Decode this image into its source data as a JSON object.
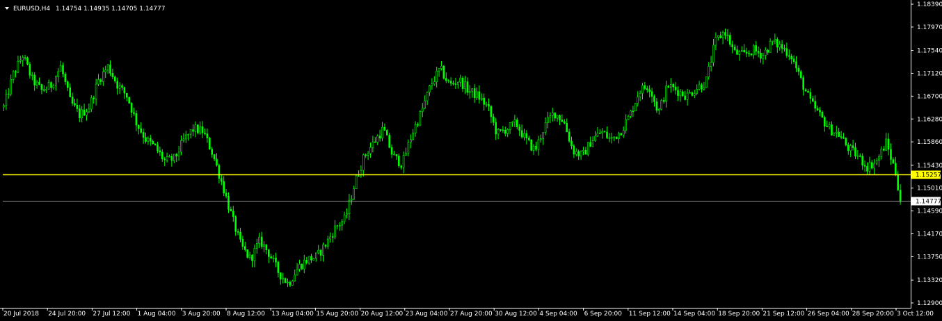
{
  "header": {
    "symbol": "EURUSD,H4",
    "ohlc": "1.14754 1.14935 1.14705 1.14777"
  },
  "chart_data": {
    "type": "candlestick",
    "symbol": "EURUSD",
    "timeframe": "H4",
    "ylim": [
      1.129,
      1.1839
    ],
    "y_ticks": [
      "1.18390",
      "1.17970",
      "1.17540",
      "1.17120",
      "1.16700",
      "1.16280",
      "1.15860",
      "1.15430",
      "1.15010",
      "1.14590",
      "1.14170",
      "1.13750",
      "1.13320",
      "1.12900"
    ],
    "x_ticks": [
      "20 Jul 2018",
      "24 Jul 20:00",
      "27 Jul 12:00",
      "1 Aug 04:00",
      "3 Aug 20:00",
      "8 Aug 12:00",
      "13 Aug 04:00",
      "15 Aug 20:00",
      "20 Aug 12:00",
      "23 Aug 04:00",
      "27 Aug 20:00",
      "30 Aug 12:00",
      "4 Sep 04:00",
      "6 Sep 20:00",
      "11 Sep 12:00",
      "14 Sep 04:00",
      "18 Sep 20:00",
      "21 Sep 12:00",
      "26 Sep 04:00",
      "28 Sep 20:00",
      "3 Oct 12:00"
    ],
    "close_path": [
      [
        0,
        1.165
      ],
      [
        4,
        1.171
      ],
      [
        8,
        1.1745
      ],
      [
        12,
        1.17
      ],
      [
        16,
        1.168
      ],
      [
        20,
        1.169
      ],
      [
        24,
        1.1725
      ],
      [
        28,
        1.166
      ],
      [
        32,
        1.1635
      ],
      [
        36,
        1.165
      ],
      [
        40,
        1.17
      ],
      [
        44,
        1.1725
      ],
      [
        48,
        1.169
      ],
      [
        52,
        1.167
      ],
      [
        56,
        1.162
      ],
      [
        60,
        1.159
      ],
      [
        64,
        1.1575
      ],
      [
        68,
        1.155
      ],
      [
        72,
        1.1555
      ],
      [
        76,
        1.159
      ],
      [
        80,
        1.161
      ],
      [
        84,
        1.1605
      ],
      [
        88,
        1.1565
      ],
      [
        92,
        1.151
      ],
      [
        96,
        1.145
      ],
      [
        100,
        1.1395
      ],
      [
        104,
        1.137
      ],
      [
        108,
        1.1405
      ],
      [
        112,
        1.138
      ],
      [
        116,
        1.1345
      ],
      [
        120,
        1.1325
      ],
      [
        124,
        1.1355
      ],
      [
        128,
        1.137
      ],
      [
        132,
        1.1375
      ],
      [
        136,
        1.14
      ],
      [
        140,
        1.143
      ],
      [
        144,
        1.1445
      ],
      [
        148,
        1.151
      ],
      [
        152,
        1.156
      ],
      [
        156,
        1.1585
      ],
      [
        160,
        1.161
      ],
      [
        164,
        1.156
      ],
      [
        168,
        1.1545
      ],
      [
        172,
        1.16
      ],
      [
        176,
        1.164
      ],
      [
        180,
        1.169
      ],
      [
        184,
        1.172
      ],
      [
        188,
        1.169
      ],
      [
        192,
        1.17
      ],
      [
        196,
        1.168
      ],
      [
        200,
        1.167
      ],
      [
        204,
        1.165
      ],
      [
        208,
        1.16
      ],
      [
        212,
        1.161
      ],
      [
        216,
        1.162
      ],
      [
        220,
        1.159
      ],
      [
        224,
        1.157
      ],
      [
        228,
        1.1615
      ],
      [
        232,
        1.164
      ],
      [
        236,
        1.1625
      ],
      [
        240,
        1.157
      ],
      [
        244,
        1.156
      ],
      [
        248,
        1.159
      ],
      [
        252,
        1.1605
      ],
      [
        256,
        1.159
      ],
      [
        260,
        1.1605
      ],
      [
        264,
        1.1635
      ],
      [
        268,
        1.168
      ],
      [
        272,
        1.169
      ],
      [
        276,
        1.164
      ],
      [
        280,
        1.169
      ],
      [
        284,
        1.168
      ],
      [
        288,
        1.167
      ],
      [
        292,
        1.1685
      ],
      [
        296,
        1.1695
      ],
      [
        300,
        1.177
      ],
      [
        304,
        1.179
      ],
      [
        308,
        1.175
      ],
      [
        312,
        1.1745
      ],
      [
        316,
        1.1755
      ],
      [
        320,
        1.1745
      ],
      [
        324,
        1.177
      ],
      [
        328,
        1.176
      ],
      [
        332,
        1.1745
      ],
      [
        336,
        1.17
      ],
      [
        340,
        1.166
      ],
      [
        344,
        1.1635
      ],
      [
        348,
        1.161
      ],
      [
        352,
        1.16
      ],
      [
        356,
        1.1575
      ],
      [
        360,
        1.156
      ],
      [
        364,
        1.154
      ],
      [
        368,
        1.155
      ],
      [
        372,
        1.1585
      ],
      [
        376,
        1.153
      ],
      [
        378,
        1.148
      ]
    ],
    "hlines": [
      {
        "value": 1.15257,
        "label": "1.15257",
        "color": "#ffff00",
        "badge_bg": "#ffff00",
        "badge_text": "#000000"
      },
      {
        "value": 1.14777,
        "label": "1.14777",
        "color": "#c0c0c0",
        "badge_bg": "#ffffff",
        "badge_text": "#000000"
      }
    ],
    "colors": {
      "candle": "#00ff00",
      "background": "#000000",
      "axis": "#ffffff"
    }
  }
}
